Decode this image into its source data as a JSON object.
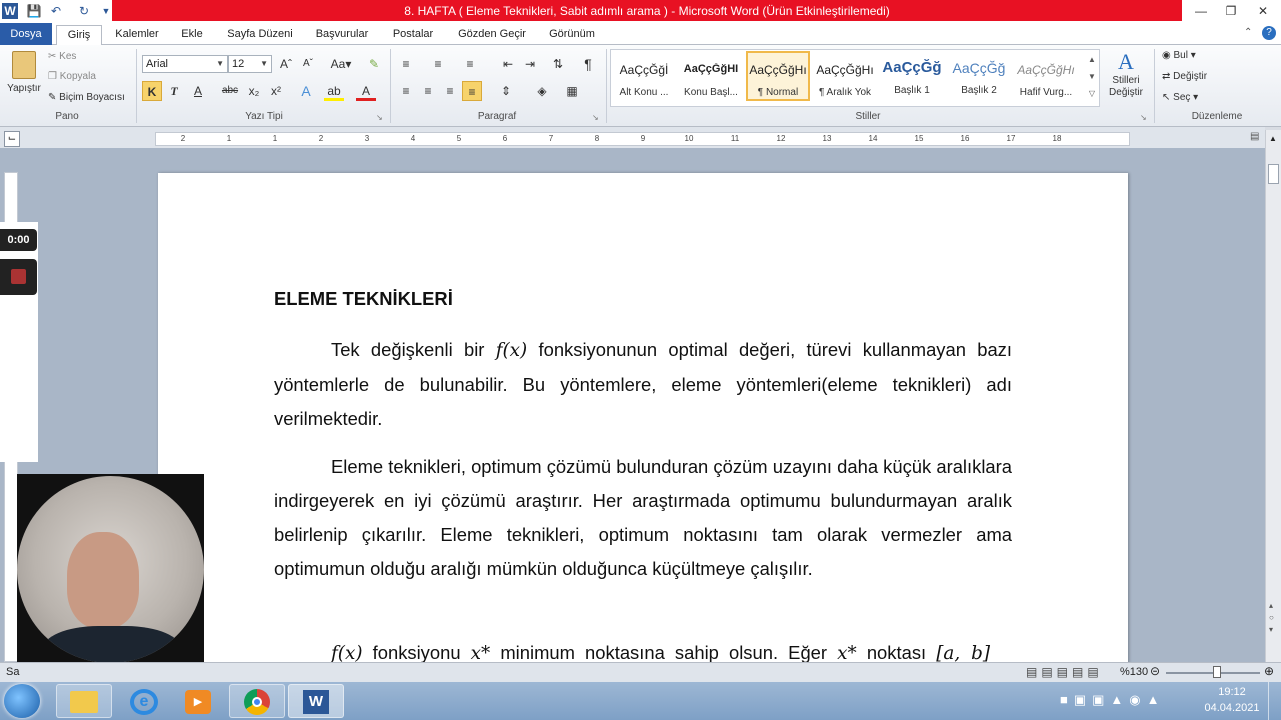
{
  "window": {
    "title": "8. HAFTA ( Eleme Teknikleri, Sabit adımlı arama )  -  Microsoft Word (Ürün Etkinleştirilemedi)"
  },
  "tabs": [
    "Dosya",
    "Giriş",
    "Kalemler",
    "Ekle",
    "Sayfa Düzeni",
    "Başvurular",
    "Postalar",
    "Gözden Geçir",
    "Görünüm"
  ],
  "ribbon": {
    "clipboard": {
      "paste": "Yapıştır",
      "cut": "Kes",
      "copy": "Kopyala",
      "format_painter": "Biçim Boyacısı",
      "group": "Pano"
    },
    "font": {
      "name": "Arial",
      "size": "12",
      "group": "Yazı Tipi"
    },
    "paragraph": {
      "group": "Paragraf"
    },
    "styles": {
      "items": [
        {
          "preview": "AaÇçĞğİ",
          "name": "Alt Konu ..."
        },
        {
          "preview": "AaÇçĞğHI",
          "name": "Konu Başl..."
        },
        {
          "preview": "AaÇçĞğHı",
          "name": "¶ Normal"
        },
        {
          "preview": "AaÇçĞğHı",
          "name": "¶ Aralık Yok"
        },
        {
          "preview": "AaÇçĞğ",
          "name": "Başlık 1"
        },
        {
          "preview": "AaÇçĞğ",
          "name": "Başlık 2"
        },
        {
          "preview": "AaÇçĞğHı",
          "name": "Hafif Vurg..."
        }
      ],
      "change": "Stilleri Değiştir",
      "group": "Stiller"
    },
    "editing": {
      "find": "Bul",
      "replace": "Değiştir",
      "select": "Seç",
      "group": "Düzenleme"
    }
  },
  "document": {
    "heading": "ELEME TEKNİKLERİ",
    "p1": {
      "pre": "Tek değişkenli bir ",
      "math": "f(x)",
      "post": " fonksiyonunun optimal değeri, türevi kullanmayan bazı yöntemlerle de bulunabilir. Bu yöntemlere, eleme yöntemleri(eleme teknikleri) adı verilmektedir."
    },
    "p2": "Eleme teknikleri, optimum çözümü bulunduran çözüm uzayını daha küçük aralıklara indirgeyerek en iyi çözümü araştırır. Her araştırmada optimumu bulundurmayan aralık belirlenip çıkarılır. Eleme teknikleri, optimum noktasını tam olarak vermezler ama optimumun olduğu aralığı mümkün olduğunca küçültmeye çalışılır.",
    "p3": {
      "math1": "f(x)",
      "t1": " fonksiyonu ",
      "math2": "x*",
      "t2": " minimum noktasına sahip olsun. Eğer ",
      "math3": "x*",
      "t3": " noktası ",
      "math4": "[a, b]"
    }
  },
  "ruler": [
    "2",
    "1",
    "1",
    "2",
    "3",
    "4",
    "5",
    "6",
    "7",
    "8",
    "9",
    "10",
    "11",
    "12",
    "13",
    "14",
    "15",
    "16",
    "17",
    "18"
  ],
  "status": {
    "left": "Sa",
    "zoom": "%130"
  },
  "recorder": {
    "timer": "0:00"
  },
  "taskbar": {
    "time": "19:12",
    "date": "04.04.2021"
  }
}
